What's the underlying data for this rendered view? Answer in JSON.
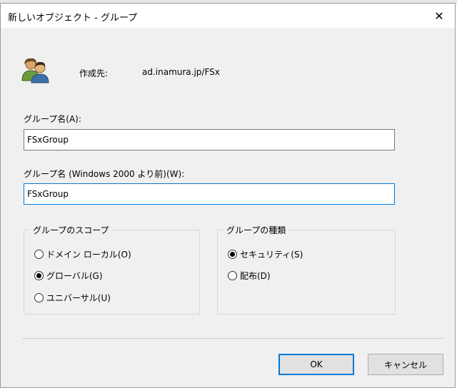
{
  "window": {
    "title": "新しいオブジェクト - グループ",
    "close_glyph": "✕"
  },
  "header": {
    "icon": "group-users-icon",
    "created_in_label": "作成先:",
    "created_in_value": "ad.inamura.jp/FSx"
  },
  "group_name": {
    "label": "グループ名(A):",
    "value": "FSxGroup"
  },
  "group_name_pre2000": {
    "label": "グループ名 (Windows 2000 より前)(W):",
    "value": "FSxGroup"
  },
  "group_scope": {
    "legend": "グループのスコープ",
    "options": [
      {
        "label": "ドメイン ローカル(O)",
        "checked": false
      },
      {
        "label": "グローバル(G)",
        "checked": true
      },
      {
        "label": "ユニバーサル(U)",
        "checked": false
      }
    ]
  },
  "group_type": {
    "legend": "グループの種類",
    "options": [
      {
        "label": "セキュリティ(S)",
        "checked": true
      },
      {
        "label": "配布(D)",
        "checked": false
      }
    ]
  },
  "buttons": {
    "ok": "OK",
    "cancel": "キャンセル"
  },
  "colors": {
    "focus_accent": "#0078d7",
    "dialog_bg": "#f0f0f0"
  }
}
